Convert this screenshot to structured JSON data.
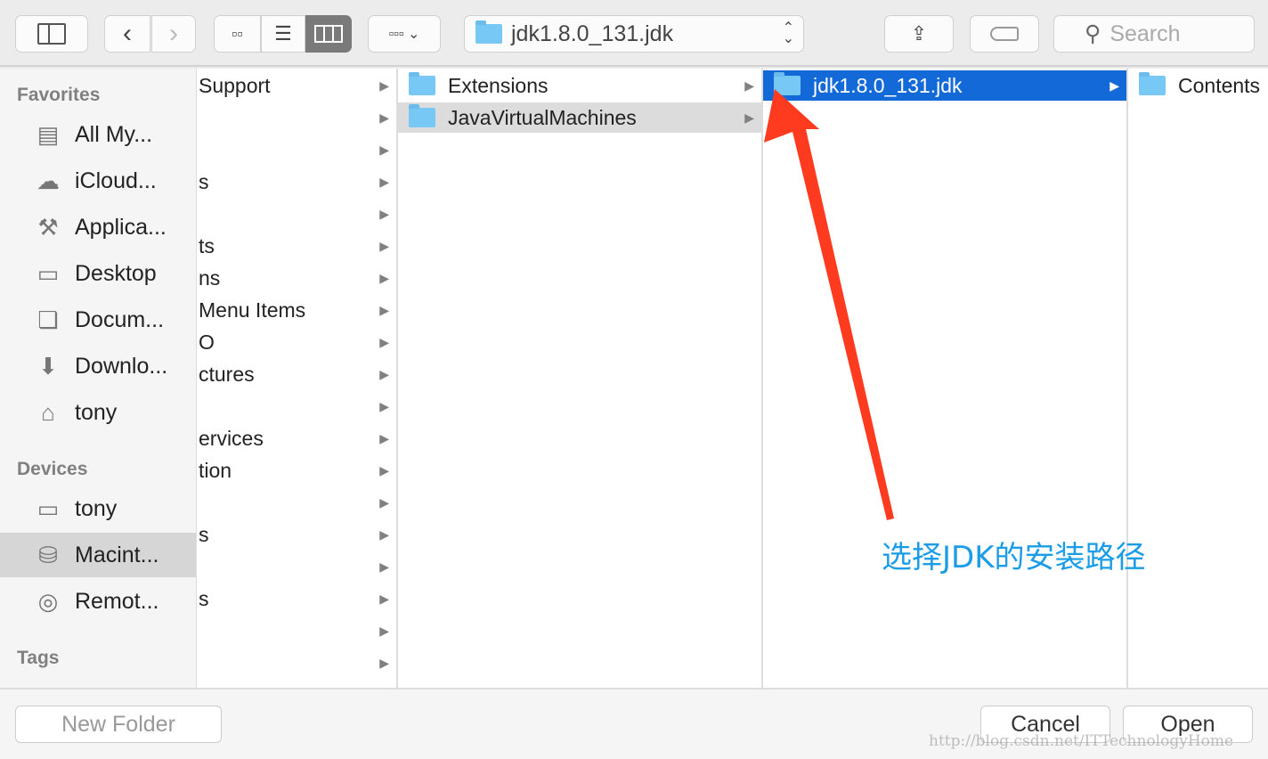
{
  "toolbar": {
    "path": "jdk1.8.0_131.jdk",
    "search_placeholder": "Search"
  },
  "sidebar": {
    "favorites_label": "Favorites",
    "favorites": [
      {
        "label": "All My...",
        "icon": "all-files-icon"
      },
      {
        "label": "iCloud...",
        "icon": "cloud-icon"
      },
      {
        "label": "Applica...",
        "icon": "applications-icon"
      },
      {
        "label": "Desktop",
        "icon": "desktop-icon"
      },
      {
        "label": "Docum...",
        "icon": "document-icon"
      },
      {
        "label": "Downlo...",
        "icon": "download-icon"
      },
      {
        "label": "tony",
        "icon": "home-icon"
      }
    ],
    "devices_label": "Devices",
    "devices": [
      {
        "label": "tony",
        "icon": "laptop-icon"
      },
      {
        "label": "Macint...",
        "icon": "disk-icon",
        "selected": true
      },
      {
        "label": "Remot...",
        "icon": "optical-disc-icon"
      }
    ],
    "tags_label": "Tags"
  },
  "columns": {
    "col1": [
      "Support",
      "",
      "",
      "s",
      "",
      "ts",
      "ns",
      "Menu Items",
      "O",
      "ctures",
      "",
      "ervices",
      "tion",
      "",
      "s",
      "",
      "s",
      "",
      ""
    ],
    "col2": [
      "Extensions",
      "JavaVirtualMachines"
    ],
    "col3": [
      "jdk1.8.0_131.jdk"
    ],
    "col4": [
      "Contents"
    ]
  },
  "annotation": {
    "text": "选择JDK的安装路径",
    "arrow_color": "#ff3b1f",
    "text_color": "#1a9ce6"
  },
  "footer": {
    "new_folder": "New Folder",
    "cancel": "Cancel",
    "open": "Open"
  },
  "watermark": "http://blog.csdn.net/ITTechnologyHome",
  "colors": {
    "selection": "#1469d8",
    "folder": "#78c8f5"
  }
}
